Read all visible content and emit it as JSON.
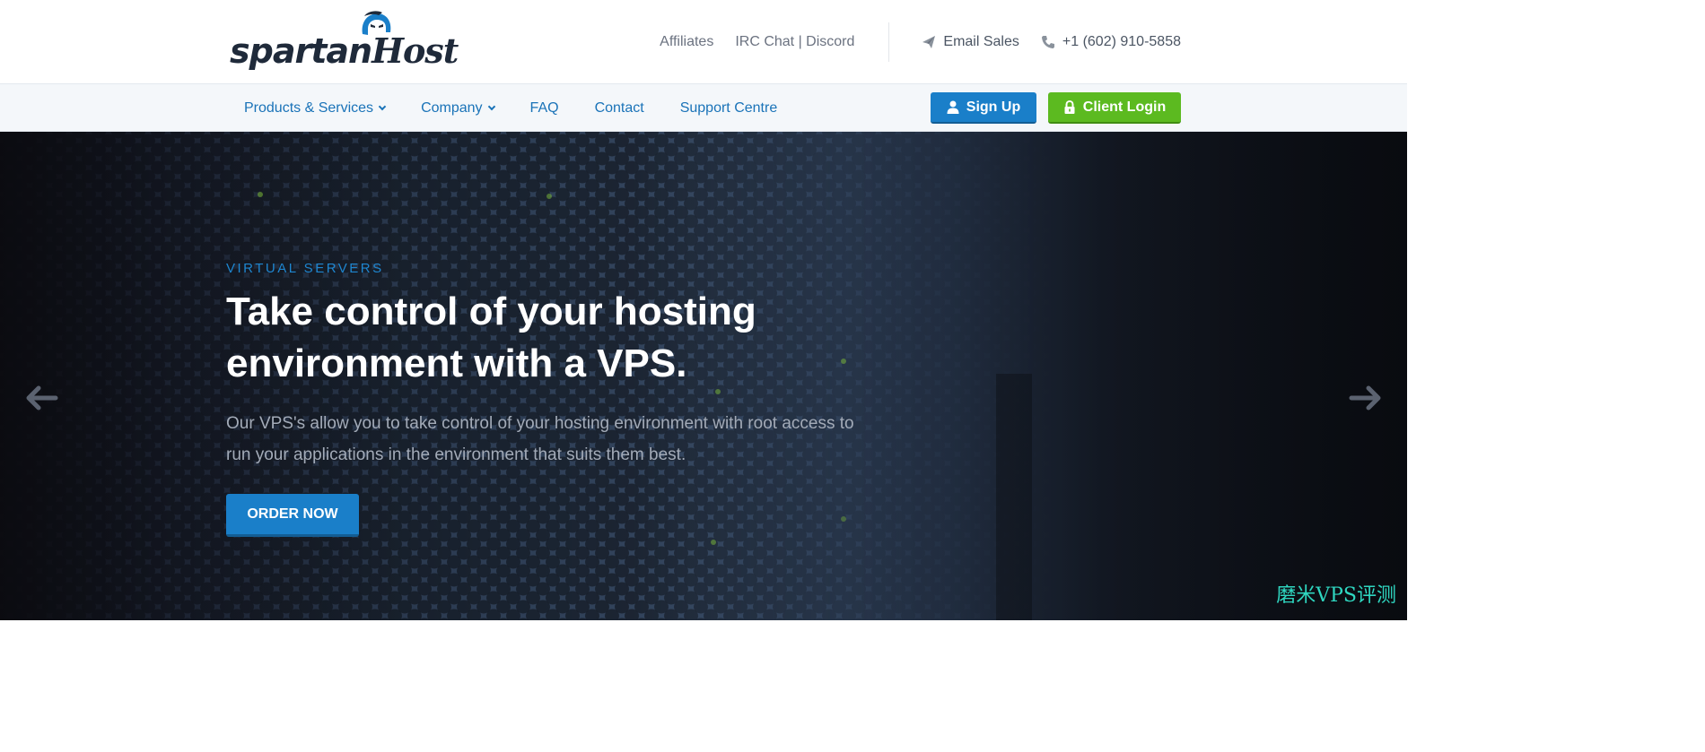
{
  "brand": {
    "logo_text": "spartan",
    "logo_text_host": "Host",
    "primary_color": "#1a7fc9",
    "login_color": "#5cba20"
  },
  "topbar": {
    "links": [
      "Affiliates",
      "IRC Chat | Discord"
    ],
    "email_label": "Email Sales",
    "email_icon": "paper-plane-icon",
    "phone_label": "+1 (602) 910-5858",
    "phone_icon": "phone-icon"
  },
  "nav": {
    "items": [
      {
        "label": "Products & Services",
        "has_dropdown": true
      },
      {
        "label": "Company",
        "has_dropdown": true
      },
      {
        "label": "FAQ",
        "has_dropdown": false
      },
      {
        "label": "Contact",
        "has_dropdown": false
      },
      {
        "label": "Support Centre",
        "has_dropdown": false
      }
    ],
    "signup_label": "Sign Up",
    "signup_icon": "user-icon",
    "login_label": "Client Login",
    "login_icon": "lock-icon"
  },
  "hero": {
    "kicker": "VIRTUAL SERVERS",
    "headline": "Take control of your hosting environment with a VPS.",
    "subtext": "Our VPS's allow you to take control of your hosting environment with root access to run your applications in the environment that suits them best.",
    "cta_label": "ORDER NOW",
    "prev_icon": "arrow-left-icon",
    "next_icon": "arrow-right-icon"
  },
  "watermark": "磨米VPS评测"
}
